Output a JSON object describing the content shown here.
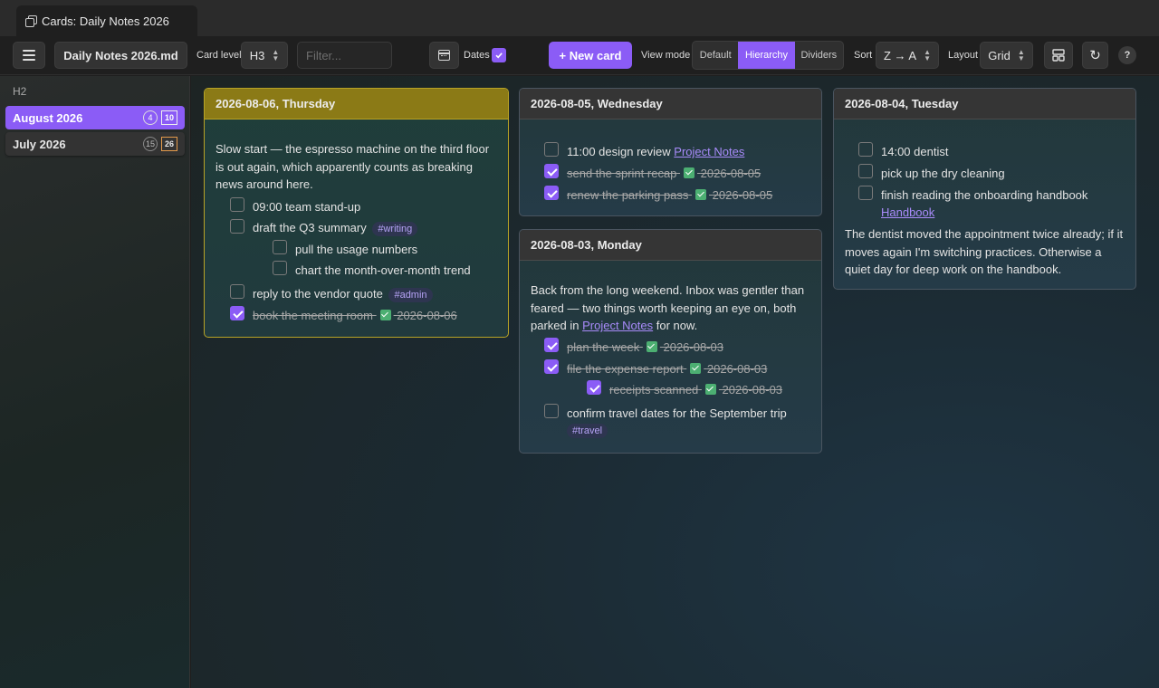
{
  "window": {
    "tab_title": "Cards: Daily Notes 2026"
  },
  "toolbar": {
    "file_name": "Daily Notes 2026.md",
    "card_level_label": "Card level",
    "card_level_value": "H3",
    "filter_placeholder": "Filter...",
    "dates_label": "Dates",
    "dates_checked": true,
    "new_card_label": "+ New card",
    "view_mode_label": "View mode",
    "view_modes": [
      "Default",
      "Hierarchy",
      "Dividers"
    ],
    "view_mode_selected": "Hierarchy",
    "sort_label": "Sort",
    "sort_value": "Z → A",
    "layout_label": "Layout",
    "layout_value": "Grid",
    "refresh_glyph": "↻",
    "help_glyph": "?"
  },
  "sidebar": {
    "heading": "H2",
    "items": [
      {
        "label": "August 2026",
        "count": "4",
        "tasks": "10",
        "active": true
      },
      {
        "label": "July 2026",
        "count": "15",
        "tasks": "26",
        "active": false
      }
    ]
  },
  "cards": {
    "thursday": {
      "title": "2026-08-06, Thursday",
      "para": "Slow start — the espresso machine on the third floor is out again, which apparently counts as breaking news around here.",
      "t1": "09:00 team stand-up",
      "t2": "draft the Q3 summary",
      "t2_tag": "#writing",
      "t2a": "pull the usage numbers",
      "t2b": "chart the month-over-month trend",
      "t3": "reply to the vendor quote",
      "t3_tag": "#admin",
      "t4": "book the meeting room",
      "t4_date": "2026-08-06"
    },
    "wednesday": {
      "title": "2026-08-05, Wednesday",
      "t1": "11:00 design review",
      "t1_link": "Project Notes",
      "t2": "send the sprint recap",
      "t2_date": "2026-08-05",
      "t3": "renew the parking pass",
      "t3_date": "2026-08-05"
    },
    "monday": {
      "title": "2026-08-03, Monday",
      "para_a": "Back from the long weekend. Inbox was gentler than feared — two things worth keeping an eye on, both parked in ",
      "para_link": "Project Notes",
      "para_b": " for now.",
      "t1": "plan the week",
      "t1_date": "2026-08-03",
      "t2": "file the expense report",
      "t2_date": "2026-08-03",
      "t2a": "receipts scanned",
      "t2a_date": "2026-08-03",
      "t3": "confirm travel dates for the September trip",
      "t3_tag": "#travel"
    },
    "tuesday": {
      "title": "2026-08-04, Tuesday",
      "t1": "14:00 dentist",
      "t2": "pick up the dry cleaning",
      "t3": "finish reading the onboarding handbook",
      "t3_link": "Handbook",
      "para": "The dentist moved the appointment twice already; if it moves again I'm switching practices. Otherwise a quiet day for deep work on the handbook."
    }
  },
  "colors": {
    "accent": "#8b5cf6",
    "highlight_header": "#8b7a16",
    "done_check": "#4caf72",
    "task_badge_border": "#e39a4b"
  },
  "icons": {
    "tab": "copy-icon",
    "menu": "hamburger-icon",
    "calendar": "calendar-icon",
    "layout": "layout-icon",
    "refresh": "refresh-icon",
    "help": "help-icon"
  }
}
